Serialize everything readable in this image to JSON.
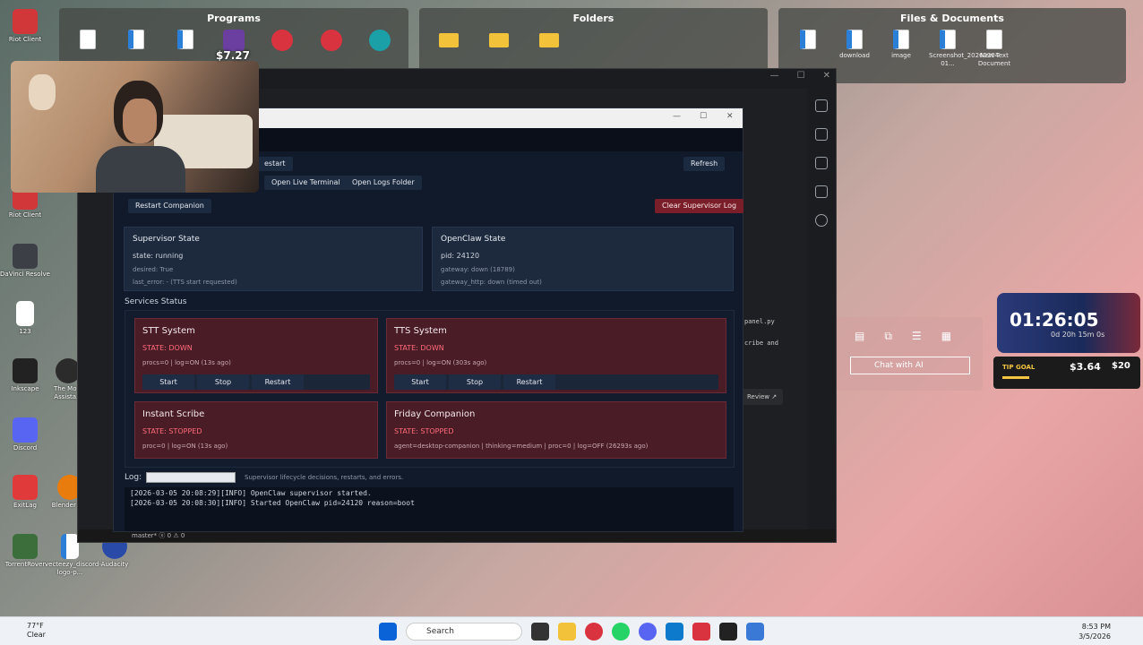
{
  "desktop": {
    "fences": [
      {
        "title": "Programs",
        "items": [
          "",
          "",
          "",
          "",
          "",
          "",
          ""
        ]
      },
      {
        "title": "Folders",
        "items": [
          "",
          "",
          ""
        ]
      },
      {
        "title": "Files & Documents",
        "items": [
          "",
          "download",
          "image",
          "Screenshot_20260204-01...",
          "New Text Document"
        ]
      }
    ],
    "left_icons": [
      "Riot Client",
      "Riot Client",
      "DaVinci Resolve",
      "123",
      "Inkscape",
      "The Mo... Assista...",
      "Discord",
      "",
      "ExitLag",
      "Blender 5.0",
      "TorrentRover",
      "vecteezy_discord-logo-p...",
      "Audacity"
    ],
    "price_overlay": "$7.27"
  },
  "supervisor": {
    "buttons": {
      "restart_top": "estart",
      "refresh": "Refresh",
      "open_live_terminal": "Open Live Terminal",
      "open_logs_folder": "Open Logs Folder",
      "restart_companion": "Restart Companion",
      "clear_supervisor_log": "Clear Supervisor Log"
    },
    "supervisor_state": {
      "title": "Supervisor State",
      "state": "state: running",
      "desired": "desired: True",
      "last_error": "last_error: - (TTS start requested)"
    },
    "openclaw_state": {
      "title": "OpenClaw State",
      "pid": "pid: 24120",
      "gateway": "gateway: down (18789)",
      "gateway_http": "gateway_http: down (timed out)"
    },
    "services_label": "Services Status",
    "services": [
      {
        "title": "STT System",
        "state": "STATE: DOWN",
        "meta": "procs=0 | log=ON (13s ago)",
        "start": "Start",
        "stop": "Stop",
        "restart": "Restart"
      },
      {
        "title": "TTS System",
        "state": "STATE: DOWN",
        "meta": "procs=0 | log=ON (303s ago)",
        "start": "Start",
        "stop": "Stop",
        "restart": "Restart"
      },
      {
        "title": "Instant Scribe",
        "state": "STATE: STOPPED",
        "meta": "proc=0 | log=ON (13s ago)"
      },
      {
        "title": "Friday Companion",
        "state": "STATE: STOPPED",
        "meta": "agent=desktop-companion | thinking=medium | proc=0 | log=OFF (26293s ago)"
      }
    ],
    "log": {
      "label": "Log:",
      "hint": "Supervisor lifecycle decisions, restarts, and errors.",
      "lines": [
        "[2026-03-05 20:08:29][INFO] OpenClaw supervisor started.",
        "[2026-03-05 20:08:30][INFO] Started OpenClaw pid=24120 reason=boot"
      ]
    }
  },
  "vscode": {
    "status": "master*   ⓧ 0 ⚠ 0",
    "snippets": [
      "panel.py",
      "cribe  and"
    ],
    "review": "Review ↗"
  },
  "widgets": {
    "chat_ai": "Chat with AI",
    "timer": "01:26:05",
    "timer_sub": "0d 20h 15m 0s",
    "tip_label": "TIP GOAL",
    "tip_amount": "$3.64",
    "tip_goal": "$20"
  },
  "taskbar": {
    "temp": "77°F",
    "weather": "Clear",
    "search": "Search",
    "time": "8:53 PM",
    "date": "3/5/2026"
  },
  "colors": {
    "accent_red": "#ff6b7a",
    "danger_button": "#7a1f2a",
    "panel_bg": "#1d2a3e"
  }
}
